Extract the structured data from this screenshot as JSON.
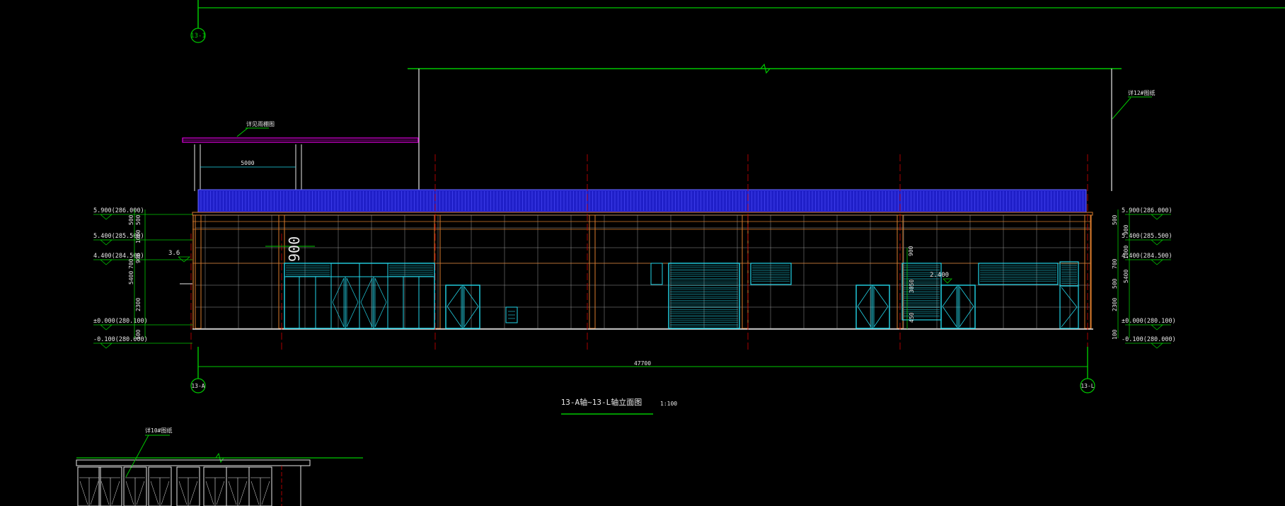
{
  "drawing": {
    "background": "#000000",
    "colors": {
      "green": "#00c800",
      "white": "#e8e8e8",
      "cyan": "#22d5e8",
      "orange": "#d77a2c",
      "red": "#d40000",
      "blue": "#1f1fc8",
      "magenta": "#e000e0",
      "gray": "#9a9a9a"
    },
    "grid_bubbles": {
      "top_left": "13-1",
      "bottom_left": "13-A",
      "bottom_right": "13-L"
    },
    "title": {
      "main": "13-A轴~13-L轴立面图",
      "scale": "1:100"
    },
    "notes": {
      "canopy_label": "详见雨棚图",
      "canopy_span": "5000",
      "right_ref": "详12#图纸",
      "bottom_ref": "详10#图纸"
    },
    "levels_left": [
      "5.900(286.000)",
      "5.400(285.500)",
      "4.400(284.500)",
      "±0.000(280.100)",
      "-0.100(280.000)"
    ],
    "levels_right": [
      "5.900(286.000)",
      "5.400(285.500)",
      "4.400(284.500)",
      "±0.000(280.100)",
      "-0.100(280.000)"
    ],
    "dims_left_inner": [
      "500",
      "1000",
      "900",
      "2300",
      "100"
    ],
    "dims_left_outer": [
      "500",
      "700",
      "5400"
    ],
    "dims_right": [
      "500",
      "900",
      "1000",
      "700",
      "5400",
      "500",
      "2300",
      "100"
    ],
    "annotations": {
      "left_small_level": "3.6",
      "big_900": "900",
      "right_900": "900",
      "right_3050": "3050",
      "right_450": "450",
      "level_2400": "2.400"
    },
    "overall_width": "47700"
  }
}
